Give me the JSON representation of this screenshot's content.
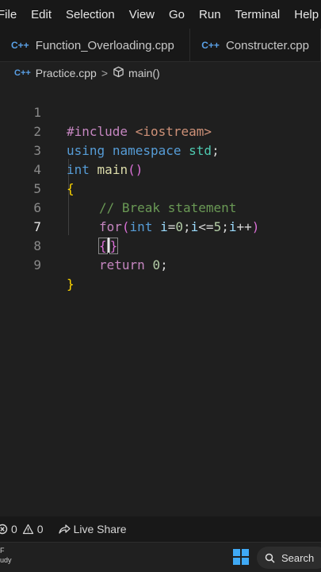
{
  "menu": [
    "File",
    "Edit",
    "Selection",
    "View",
    "Go",
    "Run",
    "Terminal",
    "Help"
  ],
  "tabs": [
    {
      "icon": "C++",
      "label": "Function_Overloading.cpp"
    },
    {
      "icon": "C++",
      "label": "Constructer.cpp"
    }
  ],
  "breadcrumb": {
    "icon": "C++",
    "file": "Practice.cpp",
    "separator": ">",
    "symbol": "main()"
  },
  "editor": {
    "line_numbers": [
      "1",
      "2",
      "3",
      "4",
      "5",
      "6",
      "7",
      "8",
      "9"
    ],
    "active_line": "7",
    "code": {
      "l1": {
        "pre": "#include",
        "inc": "<iostream>"
      },
      "l2": {
        "kw1": "using",
        "kw2": "namespace",
        "ns": "std",
        "semi": ";"
      },
      "l3": {
        "type": "int",
        "fn": "main",
        "parens": "()"
      },
      "l4": {
        "brace": "{"
      },
      "l5": {
        "comment": "// Break statement"
      },
      "l6": {
        "for": "for",
        "open": "(",
        "type": "int",
        "v1": "i",
        "p1": "=",
        "n0": "0",
        "p2": ";",
        "v2": "i",
        "p3": "<=",
        "n5": "5",
        "p4": ";",
        "v3": "i",
        "p5": "++",
        "close": ")"
      },
      "l7": {
        "open": "{",
        "close": "}"
      },
      "l8": {
        "ret": "return",
        "n0": "0",
        "semi": ";"
      },
      "l9": {
        "brace": "}"
      }
    }
  },
  "status": {
    "errors": "0",
    "warnings": "0",
    "live_share": "Live Share"
  },
  "taskbar": {
    "weather_line1": "F",
    "weather_line2": "udy",
    "search_label": "Search"
  },
  "colors": {
    "accent": "#3fa9f5",
    "keyword": "#569cd6",
    "comment": "#6a9955",
    "string": "#ce9178"
  }
}
